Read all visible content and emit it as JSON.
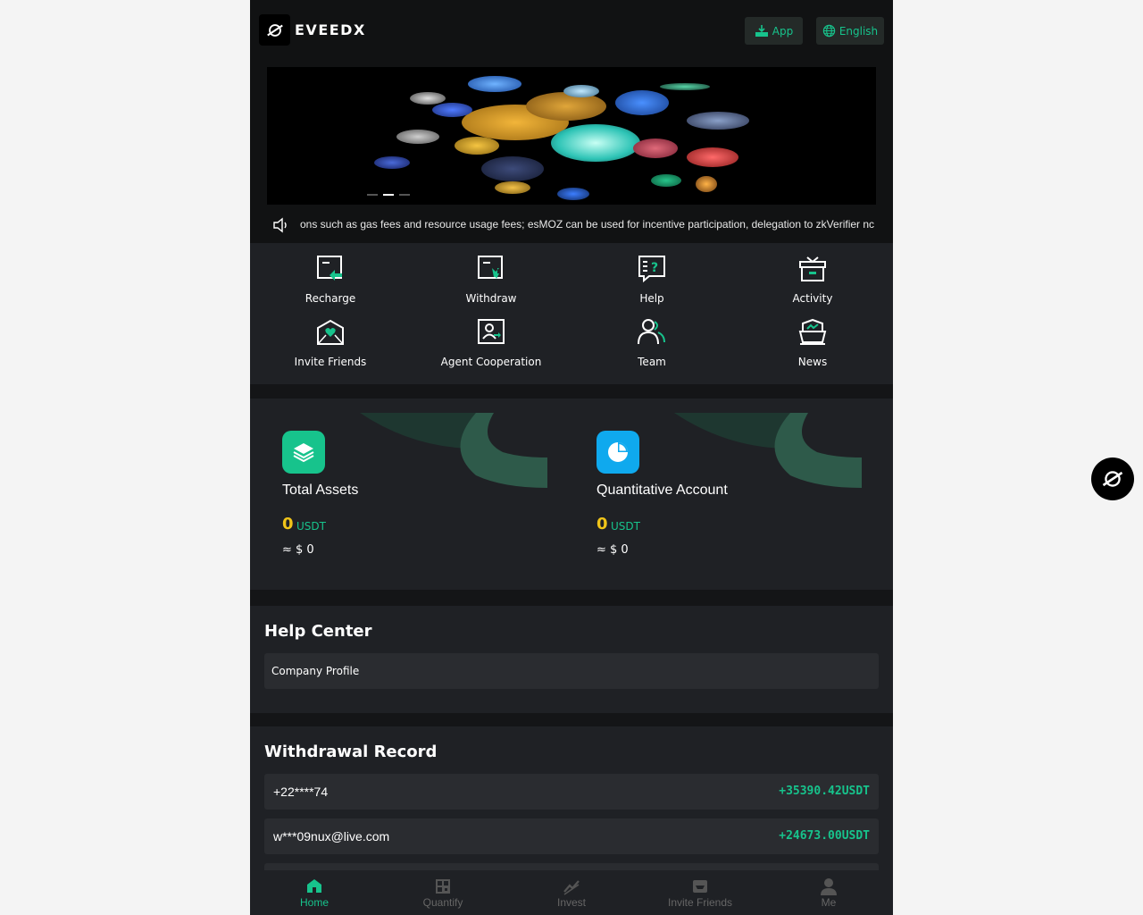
{
  "header": {
    "brand": "EVEEDX",
    "app_button": "App",
    "language_button": "English"
  },
  "banner": {
    "slides": 3,
    "active_slide": 2
  },
  "ticker": {
    "text": "ons such as gas fees and resource usage fees; esMOZ can be used for incentive participation, delegation to zkVerifier nc"
  },
  "menu": {
    "items": [
      {
        "label": "Recharge",
        "icon": "recharge-icon"
      },
      {
        "label": "Withdraw",
        "icon": "withdraw-icon"
      },
      {
        "label": "Help",
        "icon": "help-icon"
      },
      {
        "label": "Activity",
        "icon": "gift-icon"
      },
      {
        "label": "Invite Friends",
        "icon": "invite-icon"
      },
      {
        "label": "Agent Cooperation",
        "icon": "agent-icon"
      },
      {
        "label": "Team",
        "icon": "team-icon"
      },
      {
        "label": "News",
        "icon": "news-icon"
      }
    ]
  },
  "assets": {
    "total": {
      "title": "Total Assets",
      "value": "0",
      "unit": "USDT",
      "approx": "≈ $ 0"
    },
    "quant": {
      "title": "Quantitative Account",
      "value": "0",
      "unit": "USDT",
      "approx": "≈ $ 0"
    }
  },
  "help_center": {
    "title": "Help Center",
    "items": [
      "Company Profile"
    ]
  },
  "withdrawals": {
    "title": "Withdrawal Record",
    "rows": [
      {
        "user": "+22****74",
        "amount": "+35390.42USDT"
      },
      {
        "user": "w***09nux@live.com",
        "amount": "+24673.00USDT"
      }
    ]
  },
  "nav": {
    "items": [
      {
        "label": "Home",
        "active": true
      },
      {
        "label": "Quantify",
        "active": false
      },
      {
        "label": "Invest",
        "active": false
      },
      {
        "label": "Invite Friends",
        "active": false
      },
      {
        "label": "Me",
        "active": false
      }
    ]
  },
  "colors": {
    "accent": "#17c38c",
    "background": "#1f2125",
    "gold": "#f0c419",
    "quant_icon": "#0fa9ee"
  }
}
